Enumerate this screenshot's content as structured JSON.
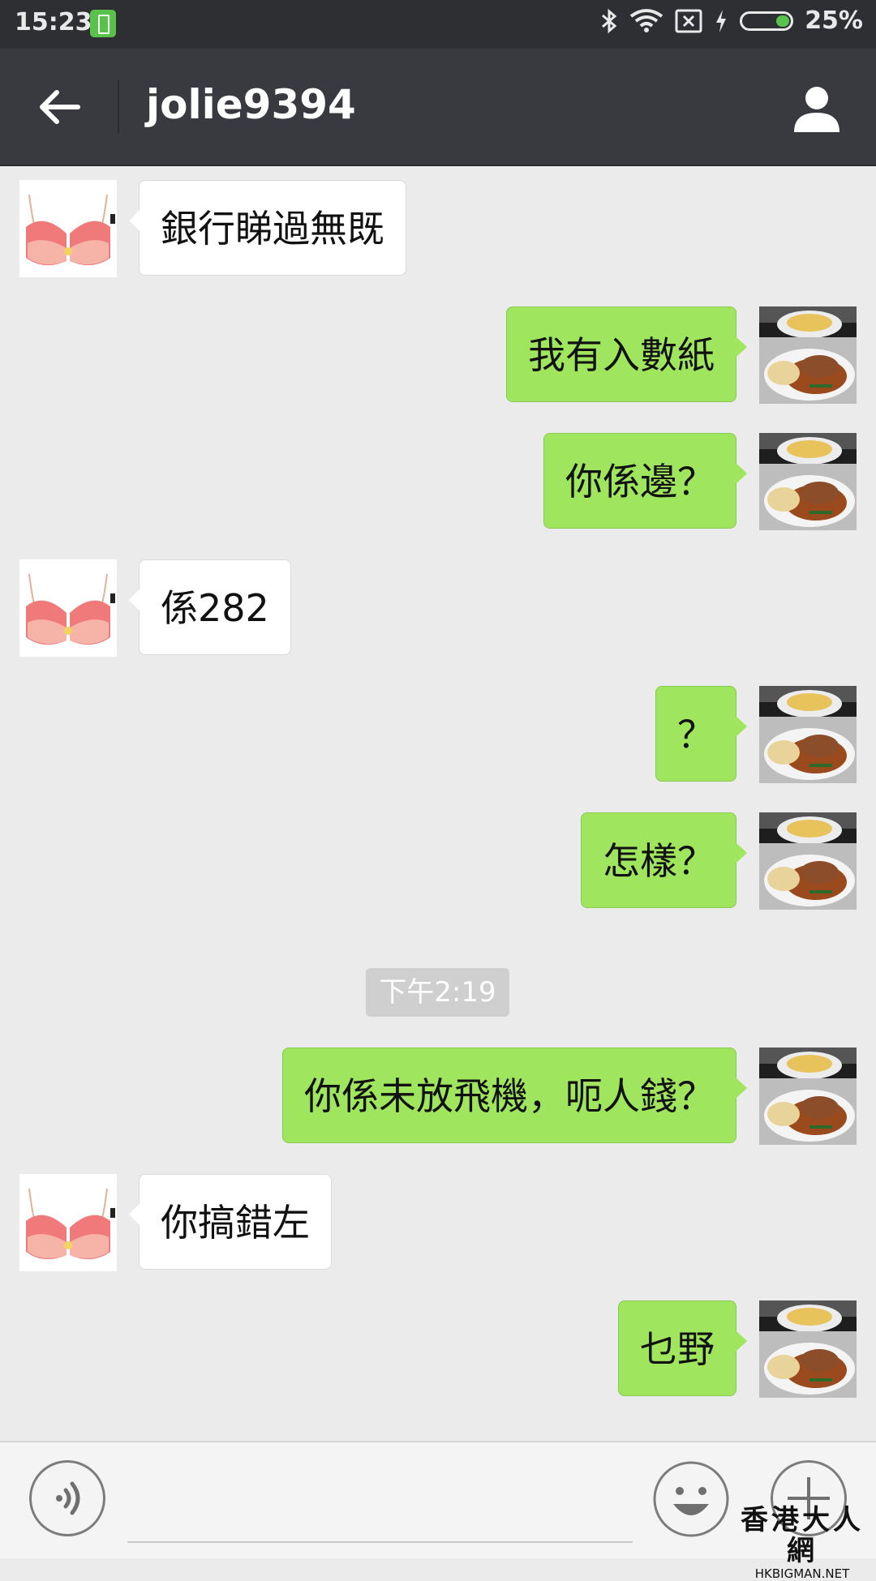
{
  "status_bar": {
    "time": "15:23",
    "battery_percent": "25%",
    "icons": [
      "battery-saver-icon",
      "bluetooth-icon",
      "wifi-icon",
      "no-sim-icon",
      "charging-icon",
      "battery-icon"
    ]
  },
  "header": {
    "title": "jolie9394",
    "back_icon": "arrow-left-icon",
    "profile_icon": "person-icon"
  },
  "messages": [
    {
      "side": "left",
      "text": "銀行睇過無既"
    },
    {
      "side": "right",
      "text": "我有入數紙"
    },
    {
      "side": "right",
      "text": "你係邊？"
    },
    {
      "side": "left",
      "text": "係282"
    },
    {
      "side": "right",
      "text": "？"
    },
    {
      "side": "right",
      "text": "怎樣？"
    },
    {
      "side": "right",
      "text": "你係未放飛機，呃人錢？"
    },
    {
      "side": "left",
      "text": "你搞錯左"
    },
    {
      "side": "right",
      "text": "乜野"
    }
  ],
  "timestamp": "下午2:19",
  "input_bar": {
    "voice_icon": "voice-icon",
    "emoji_icon": "emoji-icon",
    "plus_icon": "plus-icon"
  },
  "watermark": {
    "cn": "香港大人網",
    "en": "HKBIGMAN.NET"
  },
  "colors": {
    "header": "#393a3f",
    "status_bar": "#2e2f33",
    "bubble_sent": "#9fe65e",
    "bubble_received": "#ffffff",
    "background": "#ebebeb"
  }
}
